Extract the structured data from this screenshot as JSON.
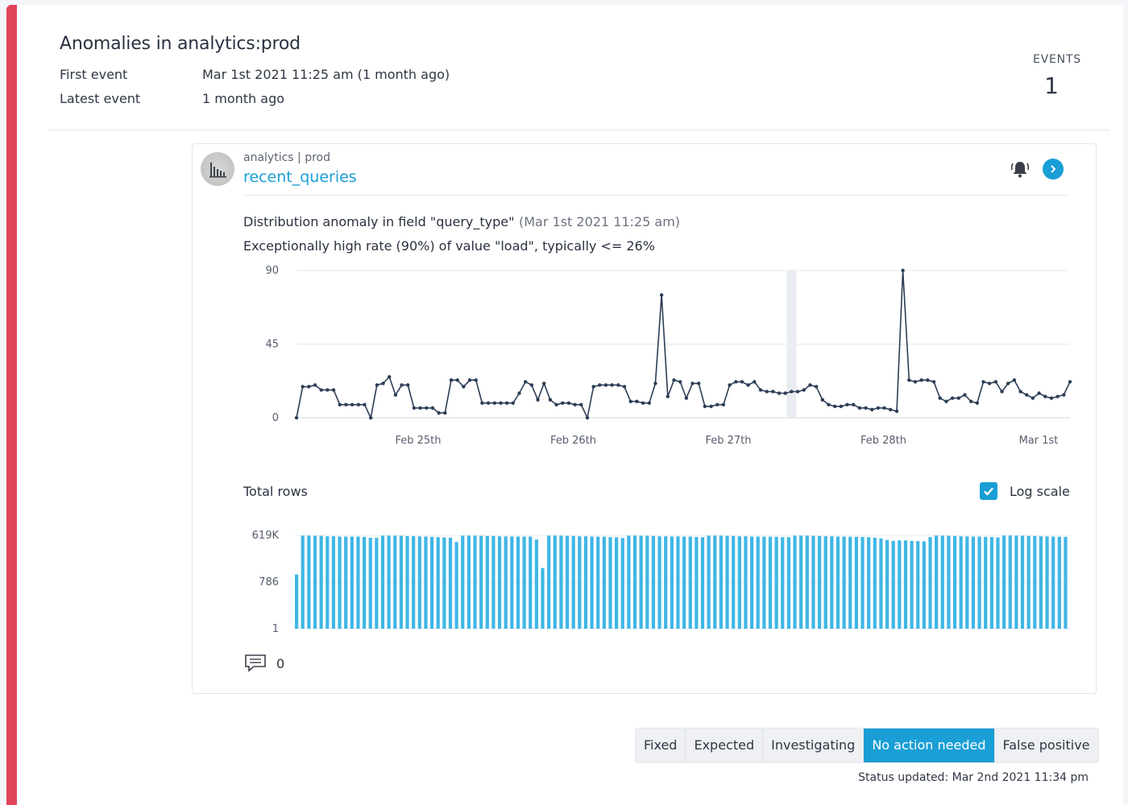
{
  "header": {
    "title": "Anomalies in analytics:prod",
    "first_event_label": "First event",
    "first_event_value": "Mar 1st 2021 11:25 am (1 month ago)",
    "latest_event_label": "Latest event",
    "latest_event_value": "1 month ago",
    "events_label": "EVENTS",
    "events_count": "1"
  },
  "card": {
    "breadcrumb": "analytics | prod",
    "table_name": "recent_queries",
    "icons": [
      "table-avatar-icon",
      "bell-icon",
      "chevron-right-icon"
    ],
    "anomaly_title": "Distribution anomaly in field \"query_type\"",
    "anomaly_time": "(Mar 1st 2021 11:25 am)",
    "anomaly_description": "Exceptionally high rate (90%) of value \"load\", typically <= 26%",
    "rows_title": "Total rows",
    "log_scale_label": "Log scale",
    "log_scale_checked": true,
    "comment_count": "0"
  },
  "colors": {
    "accent": "#1a9ed6",
    "alert_stripe": "#e0455a",
    "line": "#2c3e55",
    "bars": "#3fb6e6"
  },
  "chart_data": [
    {
      "type": "line",
      "title": "",
      "xlabel": "",
      "ylabel": "",
      "ylim": [
        0,
        90
      ],
      "yticks": [
        "0",
        "45",
        "90"
      ],
      "xticks": [
        "Feb 25th",
        "Feb 26th",
        "Feb 27th",
        "Feb 28th",
        "Mar 1st"
      ],
      "grid": true,
      "highlight_index": 80,
      "series": [
        {
          "values": [
            0,
            19,
            19,
            20,
            17,
            17,
            17,
            8,
            8,
            8,
            8,
            8,
            0,
            20,
            21,
            25,
            14,
            20,
            20,
            6,
            6,
            6,
            6,
            3,
            3,
            23,
            23,
            19,
            23,
            23,
            9,
            9,
            9,
            9,
            9,
            9,
            15,
            22,
            20,
            11,
            21,
            11,
            8,
            9,
            9,
            8,
            8,
            0,
            19,
            20,
            20,
            20,
            20,
            19,
            10,
            10,
            9,
            9,
            21,
            75,
            13,
            23,
            22,
            12,
            21,
            21,
            7,
            7,
            8,
            8,
            20,
            22,
            22,
            20,
            22,
            17,
            16,
            16,
            15,
            15,
            16,
            16,
            17,
            20,
            19,
            11,
            8,
            7,
            7,
            8,
            8,
            6,
            6,
            5,
            6,
            6,
            5,
            4,
            90,
            23,
            22,
            23,
            23,
            22,
            12,
            10,
            12,
            12,
            14,
            10,
            9,
            22,
            21,
            22,
            16,
            21,
            23,
            16,
            14,
            12,
            15,
            13,
            12,
            13,
            14,
            22
          ]
        }
      ]
    },
    {
      "type": "bar",
      "title": "Total rows",
      "scale": "log",
      "yticks": [
        "1",
        "786",
        "619K"
      ],
      "ylim": [
        1,
        619000
      ],
      "grid": true,
      "series": [
        {
          "values": [
            2300,
            590000,
            590000,
            580000,
            575000,
            540000,
            540000,
            520000,
            520000,
            520000,
            520000,
            500000,
            440000,
            430000,
            590000,
            590000,
            585000,
            580000,
            550000,
            550000,
            530000,
            525000,
            500000,
            480000,
            460000,
            440000,
            240000,
            590000,
            590000,
            585000,
            575000,
            560000,
            560000,
            540000,
            530000,
            530000,
            520000,
            520000,
            520000,
            340000,
            5800,
            590000,
            590000,
            585000,
            570000,
            560000,
            540000,
            540000,
            520000,
            510000,
            510000,
            480000,
            470000,
            420000,
            590000,
            590000,
            580000,
            575000,
            560000,
            540000,
            540000,
            530000,
            530000,
            520000,
            520000,
            490000,
            470000,
            590000,
            590000,
            585000,
            570000,
            560000,
            540000,
            540000,
            520000,
            520000,
            515000,
            510000,
            500000,
            480000,
            470000,
            590000,
            590000,
            585000,
            570000,
            560000,
            540000,
            540000,
            520000,
            520000,
            510000,
            500000,
            490000,
            470000,
            440000,
            400000,
            320000,
            280000,
            300000,
            300000,
            280000,
            270000,
            260000,
            480000,
            600000,
            590000,
            580000,
            560000,
            540000,
            530000,
            520000,
            520000,
            500000,
            480000,
            460000,
            600000,
            600000,
            590000,
            580000,
            570000,
            560000,
            540000,
            530000,
            520000,
            510000,
            500000
          ]
        }
      ]
    }
  ],
  "status": {
    "buttons": [
      {
        "label": "Fixed",
        "active": false
      },
      {
        "label": "Expected",
        "active": false
      },
      {
        "label": "Investigating",
        "active": false
      },
      {
        "label": "No action needed",
        "active": true
      },
      {
        "label": "False positive",
        "active": false
      }
    ],
    "updated_text": "Status updated: Mar 2nd 2021 11:34 pm"
  }
}
